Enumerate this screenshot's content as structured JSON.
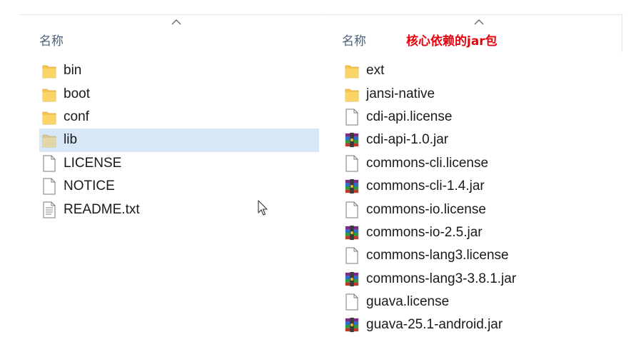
{
  "left_pane": {
    "column_header": "名称",
    "items": [
      {
        "name": "bin",
        "icon": "folder-icon",
        "selected": false
      },
      {
        "name": "boot",
        "icon": "folder-icon",
        "selected": false
      },
      {
        "name": "conf",
        "icon": "folder-icon",
        "selected": false
      },
      {
        "name": "lib",
        "icon": "folder-icon",
        "selected": true
      },
      {
        "name": "LICENSE",
        "icon": "file-icon",
        "selected": false
      },
      {
        "name": "NOTICE",
        "icon": "file-icon",
        "selected": false
      },
      {
        "name": "README.txt",
        "icon": "text-file-icon",
        "selected": false
      }
    ]
  },
  "right_pane": {
    "column_header": "名称",
    "annotation": "核心依赖的jar包",
    "items": [
      {
        "name": "ext",
        "icon": "folder-icon"
      },
      {
        "name": "jansi-native",
        "icon": "folder-icon"
      },
      {
        "name": "cdi-api.license",
        "icon": "file-icon"
      },
      {
        "name": "cdi-api-1.0.jar",
        "icon": "jar-archive-icon"
      },
      {
        "name": "commons-cli.license",
        "icon": "file-icon"
      },
      {
        "name": "commons-cli-1.4.jar",
        "icon": "jar-archive-icon"
      },
      {
        "name": "commons-io.license",
        "icon": "file-icon"
      },
      {
        "name": "commons-io-2.5.jar",
        "icon": "jar-archive-icon"
      },
      {
        "name": "commons-lang3.license",
        "icon": "file-icon"
      },
      {
        "name": "commons-lang3-3.8.1.jar",
        "icon": "jar-archive-icon"
      },
      {
        "name": "guava.license",
        "icon": "file-icon"
      },
      {
        "name": "guava-25.1-android.jar",
        "icon": "jar-archive-icon"
      }
    ]
  },
  "colors": {
    "selection": "#d9e8f7",
    "annotation": "#e8000b",
    "header_text": "#4c607a",
    "folder": "#f6c64f"
  }
}
